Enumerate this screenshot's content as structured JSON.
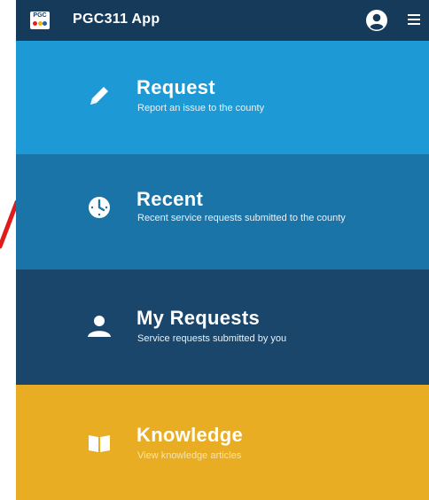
{
  "app": {
    "title": "PGC311 App",
    "logo_text": "PGC",
    "icons": {
      "logo": "pgc-logo-icon",
      "avatar": "user-avatar-icon",
      "menu": "hamburger-menu-icon"
    }
  },
  "tiles": [
    {
      "title": "Request",
      "subtitle": "Report an issue to the county",
      "icon": "pencil-icon",
      "color": "#1d9ad6"
    },
    {
      "title": "Recent",
      "subtitle": "Recent service requests submitted to the county",
      "icon": "clock-icon",
      "color": "#1b74a8"
    },
    {
      "title": "My Requests",
      "subtitle": "Service requests submitted by you",
      "icon": "person-icon",
      "color": "#19466a"
    },
    {
      "title": "Knowledge",
      "subtitle": "View knowledge articles",
      "icon": "book-icon",
      "color": "#e8ad22"
    }
  ],
  "colors": {
    "appbar": "#163a59",
    "annotation_stroke": "#e01b1b"
  }
}
